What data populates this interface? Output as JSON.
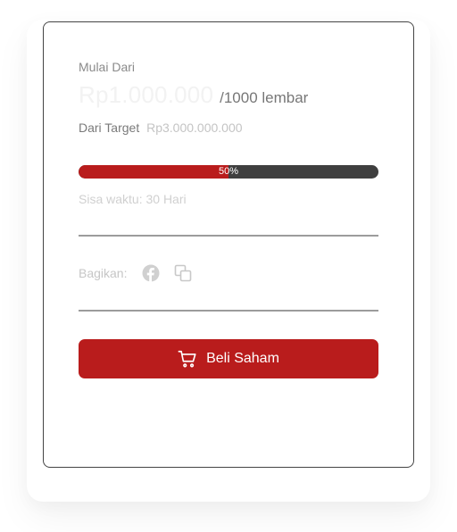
{
  "offer": {
    "start_label": "Mulai Dari",
    "price": "Rp1.000.000",
    "unit": "/1000 lembar",
    "target_label": "Dari Target",
    "target_value": "Rp3.000.000.000"
  },
  "progress": {
    "percent": 50,
    "label": "50%"
  },
  "time_left": "Sisa waktu: 30 Hari",
  "share": {
    "label": "Bagikan:",
    "icons": [
      "facebook-icon",
      "copy-icon"
    ]
  },
  "buy_button": {
    "label": "Beli Saham",
    "icon": "cart-icon"
  },
  "colors": {
    "accent": "#b91c1c",
    "progress_track": "#3f3f3f",
    "border": "#444444"
  }
}
